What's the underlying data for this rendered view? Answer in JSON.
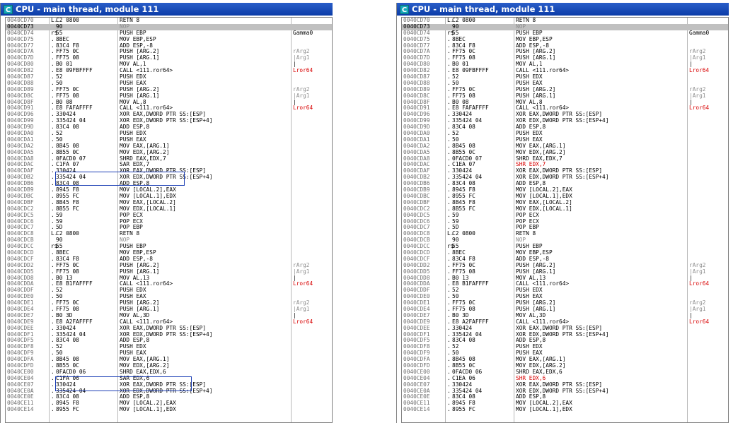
{
  "windows": [
    {
      "title": "CPU - main thread, module 111",
      "icon_letter": "C",
      "rows": [
        {
          "a": "0040CD70",
          "m": "L.",
          "h": "C2 0800",
          "d": "RETN 8",
          "c": ""
        },
        {
          "a": "0040CD73",
          "m": "",
          "h": "90",
          "d": "NOP",
          "c": "",
          "sel": true,
          "nop": true
        },
        {
          "a": "0040CD74",
          "m": "r$",
          "h": "55",
          "d": "PUSH EBP",
          "c": "Gamma0"
        },
        {
          "a": "0040CD75",
          "m": ".",
          "h": "8BEC",
          "d": "MOV EBP,ESP",
          "c": ""
        },
        {
          "a": "0040CD77",
          "m": ".",
          "h": "83C4 F8",
          "d": "ADD ESP,-8",
          "c": ""
        },
        {
          "a": "0040CD7A",
          "m": ".",
          "h": "FF75 0C",
          "d": "PUSH [ARG.2]",
          "c": "rArg2",
          "cg": true
        },
        {
          "a": "0040CD7D",
          "m": ".",
          "h": "FF75 08",
          "d": "PUSH [ARG.1]",
          "c": "|Arg1",
          "cg": true
        },
        {
          "a": "0040CD80",
          "m": ".",
          "h": "B0 01",
          "d": "MOV AL,1",
          "c": "|"
        },
        {
          "a": "0040CD82",
          "m": ".",
          "h": "E8 09FBFFFF",
          "d": "CALL <111.ror64>",
          "c": "Lror64",
          "cr": true
        },
        {
          "a": "0040CD87",
          "m": ".",
          "h": "52",
          "d": "PUSH EDX",
          "c": ""
        },
        {
          "a": "0040CD88",
          "m": ".",
          "h": "50",
          "d": "PUSH EAX",
          "c": ""
        },
        {
          "a": "0040CD89",
          "m": ".",
          "h": "FF75 0C",
          "d": "PUSH [ARG.2]",
          "c": "rArg2",
          "cg": true
        },
        {
          "a": "0040CD8C",
          "m": ".",
          "h": "FF75 08",
          "d": "PUSH [ARG.1]",
          "c": "|Arg1",
          "cg": true
        },
        {
          "a": "0040CD8F",
          "m": ".",
          "h": "B0 08",
          "d": "MOV AL,8",
          "c": "|"
        },
        {
          "a": "0040CD91",
          "m": ".",
          "h": "E8 FAFAFFFF",
          "d": "CALL <111.ror64>",
          "c": "Lror64",
          "cr": true
        },
        {
          "a": "0040CD96",
          "m": ".",
          "h": "330424",
          "d": "XOR EAX,DWORD PTR SS:[ESP]",
          "c": ""
        },
        {
          "a": "0040CD99",
          "m": ".",
          "h": "335424 04",
          "d": "XOR EDX,DWORD PTR SS:[ESP+4]",
          "c": ""
        },
        {
          "a": "0040CD9D",
          "m": ".",
          "h": "83C4 08",
          "d": "ADD ESP,8",
          "c": ""
        },
        {
          "a": "0040CDA0",
          "m": ".",
          "h": "52",
          "d": "PUSH EDX",
          "c": ""
        },
        {
          "a": "0040CDA1",
          "m": ".",
          "h": "50",
          "d": "PUSH EAX",
          "c": ""
        },
        {
          "a": "0040CDA2",
          "m": ".",
          "h": "8B45 08",
          "d": "MOV EAX,[ARG.1]",
          "c": ""
        },
        {
          "a": "0040CDA5",
          "m": ".",
          "h": "8B55 0C",
          "d": "MOV EDX,[ARG.2]",
          "c": ""
        },
        {
          "a": "0040CDA8",
          "m": ".",
          "h": "0FACD0 07",
          "d": "SHRD EAX,EDX,7",
          "c": ""
        },
        {
          "a": "0040CDAC",
          "m": ".",
          "h": "C1FA 07",
          "d": "SAR EDX,7",
          "c": ""
        },
        {
          "a": "0040CDAF",
          "m": ".",
          "h": "330424",
          "d": "XOR EAX,DWORD PTR SS:[ESP]",
          "c": ""
        },
        {
          "a": "0040CDB2",
          "m": ".",
          "h": "335424 04",
          "d": "XOR EDX,DWORD PTR SS:[ESP+4]",
          "c": ""
        },
        {
          "a": "0040CDB6",
          "m": ".",
          "h": "83C4 08",
          "d": "ADD ESP,8",
          "c": ""
        },
        {
          "a": "0040CDB9",
          "m": ".",
          "h": "8945 F8",
          "d": "MOV [LOCAL.2],EAX",
          "c": ""
        },
        {
          "a": "0040CDBC",
          "m": ".",
          "h": "8955 FC",
          "d": "MOV [LOCAL.1],EDX",
          "c": ""
        },
        {
          "a": "0040CDBF",
          "m": ".",
          "h": "8B45 F8",
          "d": "MOV EAX,[LOCAL.2]",
          "c": ""
        },
        {
          "a": "0040CDC2",
          "m": ".",
          "h": "8B55 FC",
          "d": "MOV EDX,[LOCAL.1]",
          "c": ""
        },
        {
          "a": "0040CDC5",
          "m": ".",
          "h": "59",
          "d": "POP ECX",
          "c": ""
        },
        {
          "a": "0040CDC6",
          "m": ".",
          "h": "59",
          "d": "POP ECX",
          "c": ""
        },
        {
          "a": "0040CDC7",
          "m": ".",
          "h": "5D",
          "d": "POP EBP",
          "c": ""
        },
        {
          "a": "0040CDC8",
          "m": "L.",
          "h": "C2 0800",
          "d": "RETN 8",
          "c": ""
        },
        {
          "a": "0040CDCB",
          "m": "",
          "h": "90",
          "d": "NOP",
          "c": "",
          "nop": true
        },
        {
          "a": "0040CDCC",
          "m": "r$",
          "h": "55",
          "d": "PUSH EBP",
          "c": ""
        },
        {
          "a": "0040CDCD",
          "m": ".",
          "h": "8BEC",
          "d": "MOV EBP,ESP",
          "c": ""
        },
        {
          "a": "0040CDCF",
          "m": ".",
          "h": "83C4 F8",
          "d": "ADD ESP,-8",
          "c": ""
        },
        {
          "a": "0040CDD2",
          "m": ".",
          "h": "FF75 0C",
          "d": "PUSH [ARG.2]",
          "c": "rArg2",
          "cg": true
        },
        {
          "a": "0040CDD5",
          "m": ".",
          "h": "FF75 08",
          "d": "PUSH [ARG.1]",
          "c": "|Arg1",
          "cg": true
        },
        {
          "a": "0040CDD8",
          "m": ".",
          "h": "B0 13",
          "d": "MOV AL,13",
          "c": "|"
        },
        {
          "a": "0040CDDA",
          "m": ".",
          "h": "E8 B1FAFFFF",
          "d": "CALL <111.ror64>",
          "c": "Lror64",
          "cr": true
        },
        {
          "a": "0040CDDF",
          "m": ".",
          "h": "52",
          "d": "PUSH EDX",
          "c": ""
        },
        {
          "a": "0040CDE0",
          "m": ".",
          "h": "50",
          "d": "PUSH EAX",
          "c": ""
        },
        {
          "a": "0040CDE1",
          "m": ".",
          "h": "FF75 0C",
          "d": "PUSH [ARG.2]",
          "c": "rArg2",
          "cg": true
        },
        {
          "a": "0040CDE4",
          "m": ".",
          "h": "FF75 08",
          "d": "PUSH [ARG.1]",
          "c": "|Arg1",
          "cg": true
        },
        {
          "a": "0040CDE7",
          "m": ".",
          "h": "B0 3D",
          "d": "MOV AL,3D",
          "c": "|"
        },
        {
          "a": "0040CDE9",
          "m": ".",
          "h": "E8 A2FAFFFF",
          "d": "CALL <111.ror64>",
          "c": "Lror64",
          "cr": true
        },
        {
          "a": "0040CDEE",
          "m": ".",
          "h": "330424",
          "d": "XOR EAX,DWORD PTR SS:[ESP]",
          "c": ""
        },
        {
          "a": "0040CDF1",
          "m": ".",
          "h": "335424 04",
          "d": "XOR EDX,DWORD PTR SS:[ESP+4]",
          "c": ""
        },
        {
          "a": "0040CDF5",
          "m": ".",
          "h": "83C4 08",
          "d": "ADD ESP,8",
          "c": ""
        },
        {
          "a": "0040CDF8",
          "m": ".",
          "h": "52",
          "d": "PUSH EDX",
          "c": ""
        },
        {
          "a": "0040CDF9",
          "m": ".",
          "h": "50",
          "d": "PUSH EAX",
          "c": ""
        },
        {
          "a": "0040CDFA",
          "m": ".",
          "h": "8B45 08",
          "d": "MOV EAX,[ARG.1]",
          "c": ""
        },
        {
          "a": "0040CDFD",
          "m": ".",
          "h": "8B55 0C",
          "d": "MOV EDX,[ARG.2]",
          "c": ""
        },
        {
          "a": "0040CE00",
          "m": ".",
          "h": "0FACD0 06",
          "d": "SHRD EAX,EDX,6",
          "c": ""
        },
        {
          "a": "0040CE04",
          "m": ".",
          "h": "C1FA 06",
          "d": "SAR EDX,6",
          "c": ""
        },
        {
          "a": "0040CE07",
          "m": ".",
          "h": "330424",
          "d": "XOR EAX,DWORD PTR SS:[ESP]",
          "c": ""
        },
        {
          "a": "0040CE0A",
          "m": ".",
          "h": "335424 04",
          "d": "XOR EDX,DWORD PTR SS:[ESP+4]",
          "c": ""
        },
        {
          "a": "0040CE0E",
          "m": ".",
          "h": "83C4 08",
          "d": "ADD ESP,8",
          "c": ""
        },
        {
          "a": "0040CE11",
          "m": ".",
          "h": "8945 F8",
          "d": "MOV [LOCAL.2],EAX",
          "c": ""
        },
        {
          "a": "0040CE14",
          "m": ".",
          "h": "8955 FC",
          "d": "MOV [LOCAL.1],EDX",
          "c": ""
        }
      ]
    },
    {
      "title": "CPU - main thread, module 111",
      "icon_letter": "C",
      "rows": [
        {
          "a": "0040CD70",
          "m": "L.",
          "h": "C2 0800",
          "d": "RETN 8",
          "c": ""
        },
        {
          "a": "0040CD73",
          "m": "",
          "h": "90",
          "d": "NOP",
          "c": "",
          "sel": true,
          "nop": true
        },
        {
          "a": "0040CD74",
          "m": "r$",
          "h": "55",
          "d": "PUSH EBP",
          "c": "Gamma0"
        },
        {
          "a": "0040CD75",
          "m": ".",
          "h": "8BEC",
          "d": "MOV EBP,ESP",
          "c": ""
        },
        {
          "a": "0040CD77",
          "m": ".",
          "h": "83C4 F8",
          "d": "ADD ESP,-8",
          "c": ""
        },
        {
          "a": "0040CD7A",
          "m": ".",
          "h": "FF75 0C",
          "d": "PUSH [ARG.2]",
          "c": "rArg2",
          "cg": true
        },
        {
          "a": "0040CD7D",
          "m": ".",
          "h": "FF75 08",
          "d": "PUSH [ARG.1]",
          "c": "|Arg1",
          "cg": true
        },
        {
          "a": "0040CD80",
          "m": ".",
          "h": "B0 01",
          "d": "MOV AL,1",
          "c": "|"
        },
        {
          "a": "0040CD82",
          "m": ".",
          "h": "E8 09FBFFFF",
          "d": "CALL <111.ror64>",
          "c": "Lror64",
          "cr": true
        },
        {
          "a": "0040CD87",
          "m": ".",
          "h": "52",
          "d": "PUSH EDX",
          "c": ""
        },
        {
          "a": "0040CD88",
          "m": ".",
          "h": "50",
          "d": "PUSH EAX",
          "c": ""
        },
        {
          "a": "0040CD89",
          "m": ".",
          "h": "FF75 0C",
          "d": "PUSH [ARG.2]",
          "c": "rArg2",
          "cg": true
        },
        {
          "a": "0040CD8C",
          "m": ".",
          "h": "FF75 08",
          "d": "PUSH [ARG.1]",
          "c": "|Arg1",
          "cg": true
        },
        {
          "a": "0040CD8F",
          "m": ".",
          "h": "B0 08",
          "d": "MOV AL,8",
          "c": "|"
        },
        {
          "a": "0040CD91",
          "m": ".",
          "h": "E8 FAFAFFFF",
          "d": "CALL <111.ror64>",
          "c": "Lror64",
          "cr": true
        },
        {
          "a": "0040CD96",
          "m": ".",
          "h": "330424",
          "d": "XOR EAX,DWORD PTR SS:[ESP]",
          "c": ""
        },
        {
          "a": "0040CD99",
          "m": ".",
          "h": "335424 04",
          "d": "XOR EDX,DWORD PTR SS:[ESP+4]",
          "c": ""
        },
        {
          "a": "0040CD9D",
          "m": ".",
          "h": "83C4 08",
          "d": "ADD ESP,8",
          "c": ""
        },
        {
          "a": "0040CDA0",
          "m": ".",
          "h": "52",
          "d": "PUSH EDX",
          "c": ""
        },
        {
          "a": "0040CDA1",
          "m": ".",
          "h": "50",
          "d": "PUSH EAX",
          "c": ""
        },
        {
          "a": "0040CDA2",
          "m": ".",
          "h": "8B45 08",
          "d": "MOV EAX,[ARG.1]",
          "c": ""
        },
        {
          "a": "0040CDA5",
          "m": ".",
          "h": "8B55 0C",
          "d": "MOV EDX,[ARG.2]",
          "c": ""
        },
        {
          "a": "0040CDA8",
          "m": ".",
          "h": "0FACD0 07",
          "d": "SHRD EAX,EDX,7",
          "c": ""
        },
        {
          "a": "0040CDAC",
          "m": ".",
          "h": "C1EA 07",
          "d": "SHR EDX,7",
          "c": "",
          "red": true
        },
        {
          "a": "0040CDAF",
          "m": ".",
          "h": "330424",
          "d": "XOR EAX,DWORD PTR SS:[ESP]",
          "c": ""
        },
        {
          "a": "0040CDB2",
          "m": ".",
          "h": "335424 04",
          "d": "XOR EDX,DWORD PTR SS:[ESP+4]",
          "c": ""
        },
        {
          "a": "0040CDB6",
          "m": ".",
          "h": "83C4 08",
          "d": "ADD ESP,8",
          "c": ""
        },
        {
          "a": "0040CDB9",
          "m": ".",
          "h": "8945 F8",
          "d": "MOV [LOCAL.2],EAX",
          "c": ""
        },
        {
          "a": "0040CDBC",
          "m": ".",
          "h": "8955 FC",
          "d": "MOV [LOCAL.1],EDX",
          "c": ""
        },
        {
          "a": "0040CDBF",
          "m": ".",
          "h": "8B45 F8",
          "d": "MOV EAX,[LOCAL.2]",
          "c": ""
        },
        {
          "a": "0040CDC2",
          "m": ".",
          "h": "8B55 FC",
          "d": "MOV EDX,[LOCAL.1]",
          "c": ""
        },
        {
          "a": "0040CDC5",
          "m": ".",
          "h": "59",
          "d": "POP ECX",
          "c": ""
        },
        {
          "a": "0040CDC6",
          "m": ".",
          "h": "59",
          "d": "POP ECX",
          "c": ""
        },
        {
          "a": "0040CDC7",
          "m": ".",
          "h": "5D",
          "d": "POP EBP",
          "c": ""
        },
        {
          "a": "0040CDC8",
          "m": "L.",
          "h": "C2 0800",
          "d": "RETN 8",
          "c": ""
        },
        {
          "a": "0040CDCB",
          "m": "",
          "h": "90",
          "d": "NOP",
          "c": "",
          "nop": true
        },
        {
          "a": "0040CDCC",
          "m": "r$",
          "h": "55",
          "d": "PUSH EBP",
          "c": ""
        },
        {
          "a": "0040CDCD",
          "m": ".",
          "h": "8BEC",
          "d": "MOV EBP,ESP",
          "c": ""
        },
        {
          "a": "0040CDCF",
          "m": ".",
          "h": "83C4 F8",
          "d": "ADD ESP,-8",
          "c": ""
        },
        {
          "a": "0040CDD2",
          "m": ".",
          "h": "FF75 0C",
          "d": "PUSH [ARG.2]",
          "c": "rArg2",
          "cg": true
        },
        {
          "a": "0040CDD5",
          "m": ".",
          "h": "FF75 08",
          "d": "PUSH [ARG.1]",
          "c": "|Arg1",
          "cg": true
        },
        {
          "a": "0040CDD8",
          "m": ".",
          "h": "B0 13",
          "d": "MOV AL,13",
          "c": "|"
        },
        {
          "a": "0040CDDA",
          "m": ".",
          "h": "E8 B1FAFFFF",
          "d": "CALL <111.ror64>",
          "c": "Lror64",
          "cr": true
        },
        {
          "a": "0040CDDF",
          "m": ".",
          "h": "52",
          "d": "PUSH EDX",
          "c": ""
        },
        {
          "a": "0040CDE0",
          "m": ".",
          "h": "50",
          "d": "PUSH EAX",
          "c": ""
        },
        {
          "a": "0040CDE1",
          "m": ".",
          "h": "FF75 0C",
          "d": "PUSH [ARG.2]",
          "c": "rArg2",
          "cg": true
        },
        {
          "a": "0040CDE4",
          "m": ".",
          "h": "FF75 08",
          "d": "PUSH [ARG.1]",
          "c": "|Arg1",
          "cg": true
        },
        {
          "a": "0040CDE7",
          "m": ".",
          "h": "B0 3D",
          "d": "MOV AL,3D",
          "c": "|"
        },
        {
          "a": "0040CDE9",
          "m": ".",
          "h": "E8 A2FAFFFF",
          "d": "CALL <111.ror64>",
          "c": "Lror64",
          "cr": true
        },
        {
          "a": "0040CDEE",
          "m": ".",
          "h": "330424",
          "d": "XOR EAX,DWORD PTR SS:[ESP]",
          "c": ""
        },
        {
          "a": "0040CDF1",
          "m": ".",
          "h": "335424 04",
          "d": "XOR EDX,DWORD PTR SS:[ESP+4]",
          "c": ""
        },
        {
          "a": "0040CDF5",
          "m": ".",
          "h": "83C4 08",
          "d": "ADD ESP,8",
          "c": ""
        },
        {
          "a": "0040CDF8",
          "m": ".",
          "h": "52",
          "d": "PUSH EDX",
          "c": ""
        },
        {
          "a": "0040CDF9",
          "m": ".",
          "h": "50",
          "d": "PUSH EAX",
          "c": ""
        },
        {
          "a": "0040CDFA",
          "m": ".",
          "h": "8B45 08",
          "d": "MOV EAX,[ARG.1]",
          "c": ""
        },
        {
          "a": "0040CDFD",
          "m": ".",
          "h": "8B55 0C",
          "d": "MOV EDX,[ARG.2]",
          "c": ""
        },
        {
          "a": "0040CE00",
          "m": ".",
          "h": "0FACD0 06",
          "d": "SHRD EAX,EDX,6",
          "c": ""
        },
        {
          "a": "0040CE04",
          "m": ".",
          "h": "C1EA 06",
          "d": "SHR EDX,6",
          "c": "",
          "red": true
        },
        {
          "a": "0040CE07",
          "m": ".",
          "h": "330424",
          "d": "XOR EAX,DWORD PTR SS:[ESP]",
          "c": ""
        },
        {
          "a": "0040CE0A",
          "m": ".",
          "h": "335424 04",
          "d": "XOR EDX,DWORD PTR SS:[ESP+4]",
          "c": ""
        },
        {
          "a": "0040CE0E",
          "m": ".",
          "h": "83C4 08",
          "d": "ADD ESP,8",
          "c": ""
        },
        {
          "a": "0040CE11",
          "m": ".",
          "h": "8945 F8",
          "d": "MOV [LOCAL.2],EAX",
          "c": ""
        },
        {
          "a": "0040CE14",
          "m": ".",
          "h": "8955 FC",
          "d": "MOV [LOCAL.1],EDX",
          "c": ""
        }
      ]
    }
  ]
}
